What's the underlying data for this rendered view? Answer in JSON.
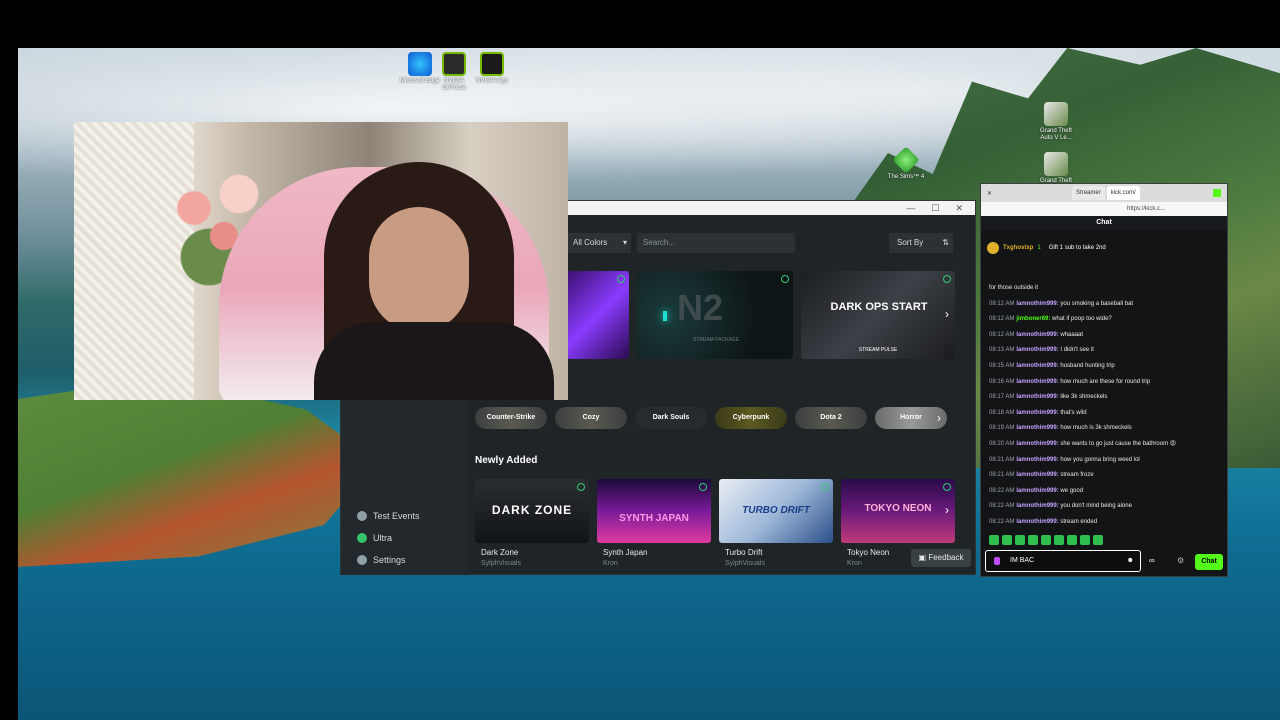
{
  "desktop": {
    "icons": [
      {
        "label": "Microsoft Edge"
      },
      {
        "label": "NVIDIA GeForce"
      },
      {
        "label": "NVIDIA App"
      },
      {
        "label": "The Sims™ 4"
      },
      {
        "label": "Grand Theft Auto V Le..."
      },
      {
        "label": "Grand Theft"
      }
    ]
  },
  "app": {
    "filter_label": "All Colors",
    "search_placeholder": "Search...",
    "sort_label": "Sort By",
    "featured": [
      {
        "title": "N2",
        "subtitle": "STREAM PACKAGE"
      },
      {
        "title": "DARK OPS START",
        "subtitle": "STREAM PULSE"
      }
    ],
    "categories": [
      "Counter-Strike",
      "Cozy",
      "Dark Souls",
      "Cyberpunk",
      "Dota 2",
      "Horror"
    ],
    "sidebar": [
      {
        "label": "Test Events"
      },
      {
        "label": "Ultra"
      },
      {
        "label": "Settings"
      }
    ],
    "newly_added_title": "Newly Added",
    "newly_added": [
      {
        "name": "Dark Zone",
        "author": "SylphVisuals",
        "art": "DARK ZONE"
      },
      {
        "name": "Synth Japan",
        "author": "Kron",
        "art": "SYNTH JAPAN"
      },
      {
        "name": "Turbo Drift",
        "author": "SylphVisuals",
        "art": "TURBO DRIFT"
      },
      {
        "name": "Tokyo Neon",
        "author": "Kron",
        "art": "TOKYO NEON"
      }
    ],
    "feedback_label": "Feedback"
  },
  "browser": {
    "tabs": [
      "Streamer",
      "kick.com/"
    ],
    "url": "https://kick.c...",
    "chat_title": "Chat",
    "pinned": {
      "user": "Txghostxp",
      "count": "1",
      "text": "Gift 1 sub to take 2nd"
    },
    "messages": [
      {
        "time": "",
        "user": "",
        "text": "for those outside it"
      },
      {
        "time": "08:12 AM",
        "user": "lamnothim999:",
        "text": "you smoking a baseball bat"
      },
      {
        "time": "08:12 AM",
        "user": "jimboner69:",
        "text": "what if poop too wide?"
      },
      {
        "time": "08:12 AM",
        "user": "lamnothim999:",
        "text": "whaaaat"
      },
      {
        "time": "08:13 AM",
        "user": "lamnothim999:",
        "text": "I didn't see it"
      },
      {
        "time": "08:15 AM",
        "user": "lamnothim999:",
        "text": "husband hunting trip"
      },
      {
        "time": "08:16 AM",
        "user": "lamnothim999:",
        "text": "how much are these for round trip"
      },
      {
        "time": "08:17 AM",
        "user": "lamnothim999:",
        "text": "like 3k shmeckels"
      },
      {
        "time": "08:18 AM",
        "user": "lamnothim999:",
        "text": "that's wild"
      },
      {
        "time": "08:19 AM",
        "user": "lamnothim999:",
        "text": "how much is 3k shmeckels"
      },
      {
        "time": "08:20 AM",
        "user": "lamnothim999:",
        "text": "she wants to go just cause the bathroom 😡"
      },
      {
        "time": "08:21 AM",
        "user": "lamnothim999:",
        "text": "how you gonna bring weed lol"
      },
      {
        "time": "08:21 AM",
        "user": "lamnothim999:",
        "text": "stream froze"
      },
      {
        "time": "08:22 AM",
        "user": "lamnothim999:",
        "text": "we good"
      },
      {
        "time": "08:22 AM",
        "user": "lamnothim999:",
        "text": "you don't mind being alone"
      },
      {
        "time": "08:22 AM",
        "user": "lamnothim999:",
        "text": "stream ended"
      }
    ],
    "input_value": "IM BAC",
    "send_label": "Chat"
  }
}
